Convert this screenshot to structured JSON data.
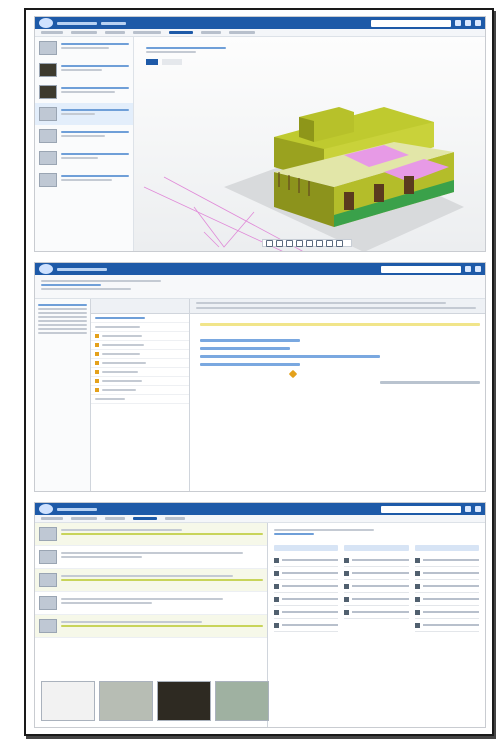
{
  "panels": [
    {
      "name": "3d-model-viewer",
      "description": ""
    },
    {
      "name": "gantt-schedule",
      "description": ""
    },
    {
      "name": "review-board",
      "description": ""
    }
  ],
  "colors": {
    "accent": "#1e5aa8",
    "building_wall": "#c9d23a",
    "roof_pink": "#e79ae6",
    "gantt_bar": "#7aa8e0",
    "milestone": "#e4a11b"
  },
  "icons": [
    "search-icon",
    "bell-icon",
    "user-icon",
    "home-icon",
    "zoom-icon",
    "pan-icon",
    "rotate-icon"
  ]
}
